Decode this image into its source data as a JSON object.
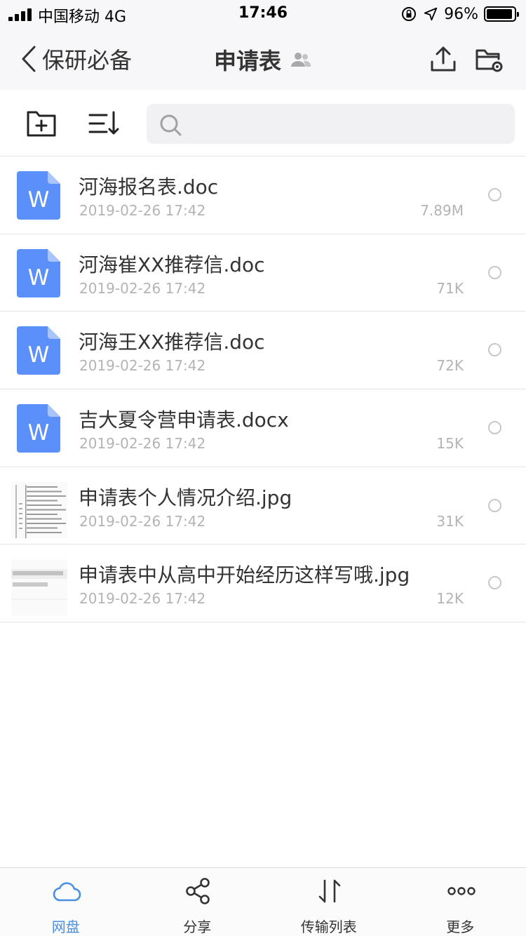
{
  "status_bar": {
    "carrier": "中国移动  4G",
    "time": "17:46",
    "battery_percent_text": "96%",
    "battery_level": 0.96
  },
  "nav": {
    "back_label": "保研必备",
    "title": "申请表",
    "shared_icon": "people-icon",
    "upload_icon": "upload-icon",
    "folder_settings_icon": "folder-settings-icon"
  },
  "toolbar": {
    "new_folder_icon": "folder-plus-icon",
    "sort_icon": "sort-icon",
    "search_placeholder": ""
  },
  "files": [
    {
      "name": "河海报名表.doc",
      "date": "2019-02-26 17:42",
      "size": "7.89M",
      "type": "word",
      "thumb_letter": "W"
    },
    {
      "name": "河海崔XX推荐信.doc",
      "date": "2019-02-26 17:42",
      "size": "71K",
      "type": "word",
      "thumb_letter": "W"
    },
    {
      "name": "河海王XX推荐信.doc",
      "date": "2019-02-26 17:42",
      "size": "72K",
      "type": "word",
      "thumb_letter": "W"
    },
    {
      "name": "吉大夏令营申请表.docx",
      "date": "2019-02-26 17:42",
      "size": "15K",
      "type": "word",
      "thumb_letter": "W"
    },
    {
      "name": "申请表个人情况介绍.jpg",
      "date": "2019-02-26 17:42",
      "size": "31K",
      "type": "image"
    },
    {
      "name": "申请表中从高中开始经历这样写哦.jpg",
      "date": "2019-02-26 17:42",
      "size": "12K",
      "type": "image"
    }
  ],
  "tabs": [
    {
      "label": "网盘",
      "icon": "cloud-icon",
      "active": true
    },
    {
      "label": "分享",
      "icon": "share-icon",
      "active": false
    },
    {
      "label": "传输列表",
      "icon": "transfer-icon",
      "active": false
    },
    {
      "label": "更多",
      "icon": "more-icon",
      "active": false
    }
  ],
  "colors": {
    "accent": "#4a90e2",
    "word_blue": "#5b8ff9",
    "secondary_text": "#b3b3b8"
  }
}
